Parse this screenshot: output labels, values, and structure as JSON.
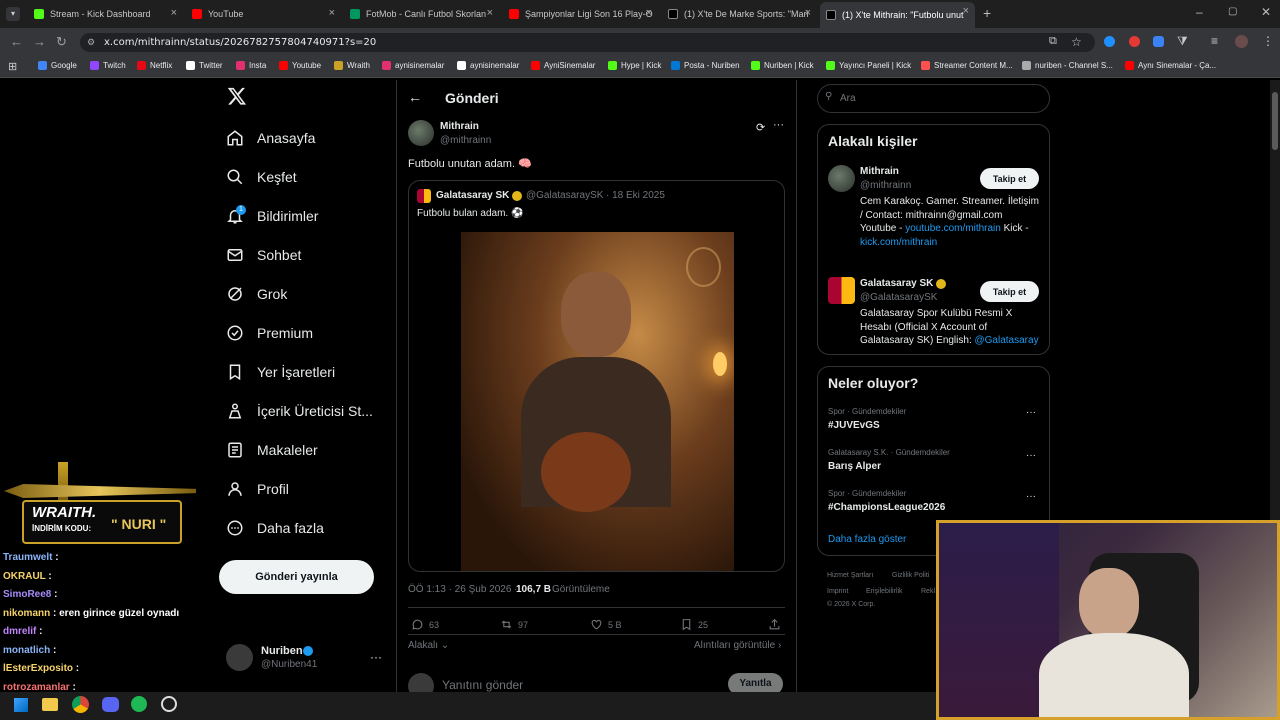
{
  "browser": {
    "tabs": [
      {
        "label": "Stream - Kick Dashboard",
        "color": "#53fc18"
      },
      {
        "label": "YouTube",
        "color": "#ff0000"
      },
      {
        "label": "FotMob - Canlı Futbol Skorlan",
        "color": "#00985f"
      },
      {
        "label": "Şampiyonlar Ligi Son 16 Play-O",
        "color": "#ff0000"
      },
      {
        "label": "(1) X'te De Marke Sports: \"Mari",
        "color": "#ffffff"
      },
      {
        "label": "(1) X'te Mithrain: \"Futbolu unut",
        "color": "#ffffff"
      }
    ],
    "new_tab": "+",
    "url": "x.com/mithrainn/status/2026782757804740971?s=20",
    "bookmarks": [
      {
        "label": "Google",
        "color": "#4285f4"
      },
      {
        "label": "Twitch",
        "color": "#9146ff"
      },
      {
        "label": "Netflix",
        "color": "#e50914"
      },
      {
        "label": "Twitter",
        "color": "#ffffff"
      },
      {
        "label": "Insta",
        "color": "#e1306c"
      },
      {
        "label": "Youtube",
        "color": "#ff0000"
      },
      {
        "label": "Wraith",
        "color": "#c9a227"
      },
      {
        "label": "aynisinemalar",
        "color": "#e1306c"
      },
      {
        "label": "aynisinemalar",
        "color": "#ffffff"
      },
      {
        "label": "AyniSinemalar",
        "color": "#ff0000"
      },
      {
        "label": "Hype | Kick",
        "color": "#53fc18"
      },
      {
        "label": "Posta - Nuriben",
        "color": "#0078d4"
      },
      {
        "label": "Nuriben | Kick",
        "color": "#53fc18"
      },
      {
        "label": "Yayıncı Paneli | Kick",
        "color": "#53fc18"
      },
      {
        "label": "Streamer Content M...",
        "color": "#ff4f4f"
      },
      {
        "label": "nuriben - Channel S...",
        "color": "#aaaaaa"
      },
      {
        "label": "Aynı Sinemalar - Ça...",
        "color": "#ff0000"
      }
    ]
  },
  "nav": {
    "logo": "X",
    "items": [
      {
        "label": "Anasayfa",
        "icon": "home-icon"
      },
      {
        "label": "Keşfet",
        "icon": "search-icon"
      },
      {
        "label": "Bildirimler",
        "icon": "bell-icon",
        "badge": "1"
      },
      {
        "label": "Sohbet",
        "icon": "mail-icon"
      },
      {
        "label": "Grok",
        "icon": "grok-icon"
      },
      {
        "label": "Premium",
        "icon": "premium-icon"
      },
      {
        "label": "Yer İşaretleri",
        "icon": "bookmark-icon"
      },
      {
        "label": "İçerik Üreticisi St...",
        "icon": "creator-icon"
      },
      {
        "label": "Makaleler",
        "icon": "article-icon"
      },
      {
        "label": "Profil",
        "icon": "profile-icon"
      },
      {
        "label": "Daha fazla",
        "icon": "more-circle-icon"
      }
    ],
    "post_button": "Gönderi yayınla",
    "account": {
      "name": "Nuriben",
      "handle": "@Nuriben41"
    }
  },
  "post": {
    "header": "Gönderi",
    "author": {
      "name": "Mithrain",
      "handle": "@mithrainn"
    },
    "text": "Futbolu unutan adam. 🧠",
    "quote": {
      "name": "Galatasaray SK",
      "handle": "@GalatasaraySK",
      "date": "· 18 Eki 2025",
      "text": "Futbolu bulan adam. ⚽"
    },
    "meta": {
      "time": "ÖÖ 1:13 · 26 Şub 2026 ·",
      "views": "106,7 B",
      "views_label": "Görüntüleme"
    },
    "actions": {
      "replies": "63",
      "reposts": "97",
      "likes": "5 B",
      "bookmarks": "25"
    },
    "related_left": "Alakalı",
    "related_right": "Alıntıları görüntüle",
    "reply_placeholder": "Yanıtını gönder",
    "reply_button": "Yanıtla"
  },
  "sidebar": {
    "search_placeholder": "Ara",
    "people_title": "Alakalı kişiler",
    "people": [
      {
        "name": "Mithrain",
        "handle": "@mithrainn",
        "follow": "Takip et",
        "bio": "Cem Karakoç. Gamer. Streamer. İletişim / Contact: mithrainn@gmail.com Youtube -",
        "link1": "youtube.com/mithrain",
        "mid": " Kick -",
        "link2": "kick.com/mithrain"
      },
      {
        "name": "Galatasaray SK",
        "handle": "@GalatasaraySK",
        "follow": "Takip et",
        "bio": "Galatasaray Spor Kulübü Resmi X Hesabı (Official X Account of Galatasaray SK) English:",
        "link1": "@Galatasaray"
      }
    ],
    "trends_title": "Neler oluyor?",
    "trends": [
      {
        "context": "Spor · Gündemdekiler",
        "topic": "#JUVEvGS"
      },
      {
        "context": "Galatasaray S.K. · Gündemdekiler",
        "topic": "Barış Alper"
      },
      {
        "context": "Spor · Gündemdekiler",
        "topic": "#ChampionsLeague2026"
      }
    ],
    "show_more": "Daha fazla göster",
    "footer": [
      "Hizmet Şartları",
      "Gizlilik Politi",
      "Imprint",
      "Erişilebilirlik",
      "Rekl",
      "© 2026 X Corp."
    ]
  },
  "overlay": {
    "brand": "WRAITH.",
    "code_label": "İNDİRİM KODU:",
    "code": "\" NURI \"",
    "chat": [
      {
        "user": "Traumwelt",
        "msg": " :",
        "color": "#8ab4f8"
      },
      {
        "user": "OKRAUL",
        "msg": " :",
        "color": "#f6d36b"
      },
      {
        "user": "SimoRee8",
        "msg": " :",
        "color": "#a78bfa"
      },
      {
        "user": "nikomann",
        "msg": " : eren girince güzel oynadı",
        "color": "#f6d36b"
      },
      {
        "user": "dmrelif",
        "msg": " :",
        "color": "#c084fc"
      },
      {
        "user": "monatlich",
        "msg": " :",
        "color": "#8ab4f8"
      },
      {
        "user": "lEsterExposito",
        "msg": " :",
        "color": "#f6d36b"
      },
      {
        "user": "rotrozamanlar",
        "msg": " :",
        "color": "#f87171"
      }
    ]
  }
}
